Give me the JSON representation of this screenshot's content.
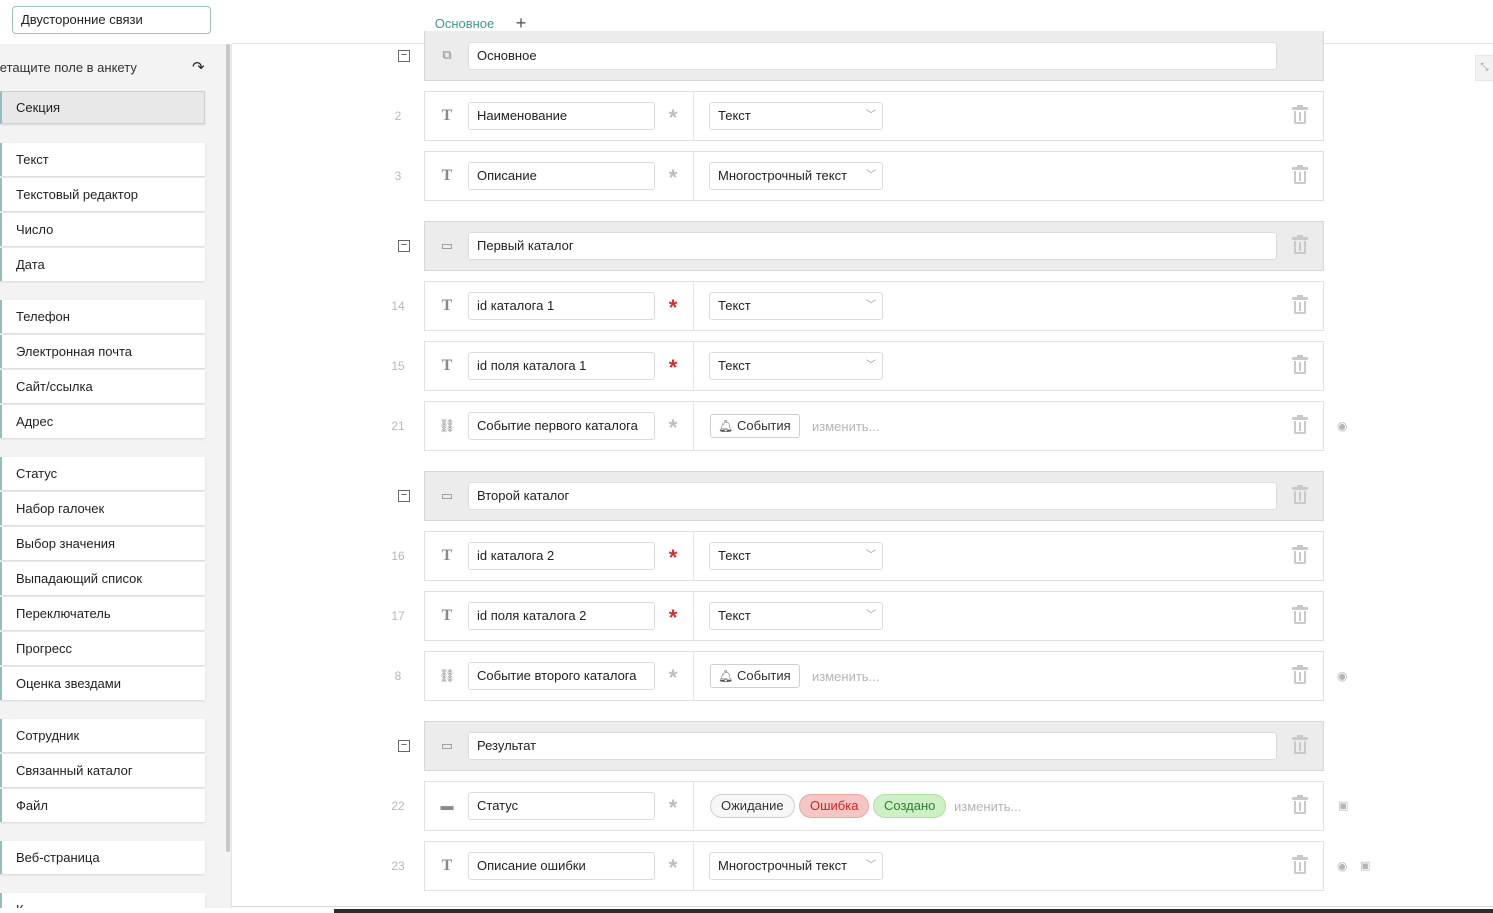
{
  "header": {
    "title_value": "Двусторонние связи",
    "tabs": [
      {
        "label": "Основное"
      }
    ],
    "add_tab_label": "+"
  },
  "sidebar": {
    "hint": "Перетащите поле в анкету",
    "items": [
      {
        "label": "Секция"
      },
      {
        "label": "Текст"
      },
      {
        "label": "Текстовый редактор"
      },
      {
        "label": "Число"
      },
      {
        "label": "Дата"
      },
      {
        "label": "Телефон"
      },
      {
        "label": "Электронная почта"
      },
      {
        "label": "Сайт/ссылка"
      },
      {
        "label": "Адрес"
      },
      {
        "label": "Статус"
      },
      {
        "label": "Набор галочек"
      },
      {
        "label": "Выбор значения"
      },
      {
        "label": "Выпадающий список"
      },
      {
        "label": "Переключатель"
      },
      {
        "label": "Прогресс"
      },
      {
        "label": "Оценка звездами"
      },
      {
        "label": "Сотрудник"
      },
      {
        "label": "Связанный каталог"
      },
      {
        "label": "Файл"
      },
      {
        "label": "Веб-страница"
      },
      {
        "label": "К"
      }
    ]
  },
  "form": {
    "change_label": "изменить...",
    "events_label": "События",
    "rows": [
      {
        "kind": "section",
        "title": "Основное"
      },
      {
        "num": "2",
        "name": "Наименование",
        "required": false,
        "type": "Текст"
      },
      {
        "num": "3",
        "name": "Описание",
        "required": false,
        "type": "Многострочный текст"
      },
      {
        "kind": "section",
        "title": "Первый каталог"
      },
      {
        "num": "14",
        "name": "id каталога 1",
        "required": true,
        "type": "Текст"
      },
      {
        "num": "15",
        "name": "id поля каталога 1",
        "required": true,
        "type": "Текст"
      },
      {
        "num": "21",
        "name": "Событие первого каталога",
        "required": false,
        "type": "События"
      },
      {
        "kind": "section",
        "title": "Второй каталог"
      },
      {
        "num": "16",
        "name": "id каталога 2",
        "required": true,
        "type": "Текст"
      },
      {
        "num": "17",
        "name": "id поля каталога 2",
        "required": true,
        "type": "Текст"
      },
      {
        "num": "8",
        "name": "Событие второго каталога",
        "required": false,
        "type": "События"
      },
      {
        "kind": "section",
        "title": "Результат"
      },
      {
        "num": "22",
        "name": "Статус",
        "required": false,
        "statuses": [
          "Ожидание",
          "Ошибка",
          "Создано"
        ]
      },
      {
        "num": "23",
        "name": "Описание ошибки",
        "required": false,
        "type": "Многострочный текст"
      }
    ]
  },
  "colors": {
    "accent": "#3a9c94",
    "required": "#d32f2f",
    "status_error_bg": "#f6c6c4",
    "status_ok_bg": "#cdf0c4"
  },
  "icons": {
    "text_field": "T",
    "link_field": "🔗",
    "section": "▭",
    "status_field": "▬",
    "required": "✱",
    "events": "bell-icon",
    "visibility": "eye-icon",
    "lock": "lock-icon",
    "delete": "trash-icon"
  }
}
